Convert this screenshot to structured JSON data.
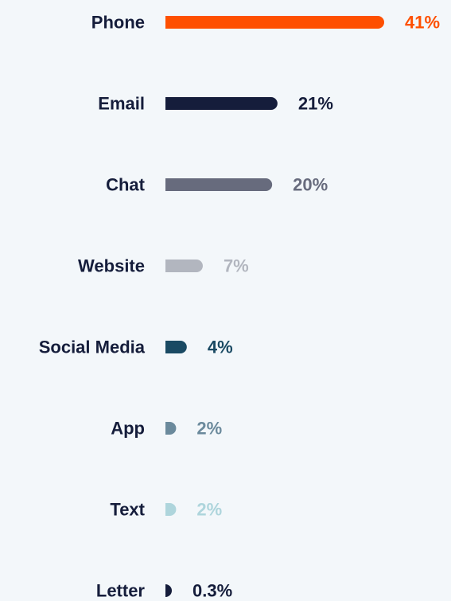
{
  "chart_data": {
    "type": "bar",
    "orientation": "horizontal",
    "title": "",
    "xlabel": "",
    "ylabel": "",
    "grid": false,
    "categories": [
      "Phone",
      "Email",
      "Chat",
      "Website",
      "Social Media",
      "App",
      "Text",
      "Letter"
    ],
    "values": [
      41,
      21,
      20,
      7,
      4,
      2,
      2,
      0.3
    ],
    "value_labels": [
      "41%",
      "21%",
      "20%",
      "7%",
      "4%",
      "2%",
      "2%",
      "0.3%"
    ],
    "unit": "%",
    "xlim": [
      0,
      41
    ],
    "colors": [
      "#fe5000",
      "#151d3b",
      "#676b7d",
      "#b2b6bf",
      "#1a4a63",
      "#6b8a9c",
      "#aed5dc",
      "#151d3b"
    ],
    "label_color": "#151d3b",
    "background": "#f3f7fa"
  }
}
